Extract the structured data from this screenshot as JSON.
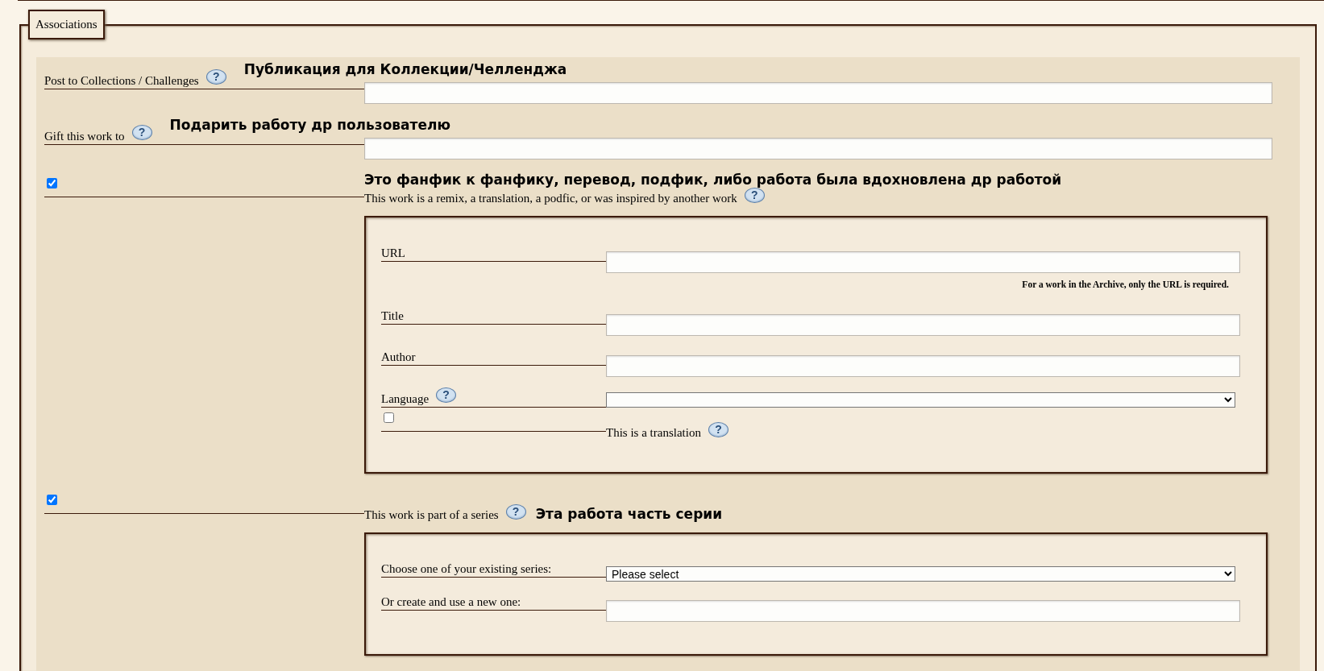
{
  "legend": "Associations",
  "rows": [
    {
      "kind": "text",
      "label": "Post to Collections / Challenges",
      "help": "?",
      "annotation": {
        "kind": "inline",
        "text": "Публикация для Коллекции/Челленджа"
      }
    },
    {
      "kind": "text",
      "label": "Gift this work to",
      "help": "?",
      "annotation": {
        "kind": "inline",
        "text": "Подарить работу др пользователю"
      }
    },
    {
      "kind": "check",
      "checked": true,
      "label": "This work is a remix, a translation, a podfic, or was inspired by another work",
      "help": "?",
      "annotation": {
        "kind": "above",
        "text": "Это фанфик к фанфику, перевод, подфик, либо работа была вдохновлена др работой"
      },
      "fields": [
        {
          "kind": "text",
          "label": "URL",
          "note": "For a work in the Archive, only the URL is required."
        },
        {
          "kind": "text",
          "label": "Title"
        },
        {
          "kind": "text",
          "label": "Author"
        },
        {
          "kind": "select",
          "label": "Language",
          "help": "?"
        },
        {
          "kind": "check",
          "checked": false,
          "label": "This is a translation",
          "help": "?"
        }
      ]
    },
    {
      "kind": "check",
      "checked": true,
      "label": "This work is part of a series",
      "help": "?",
      "annotation": {
        "kind": "inline",
        "text": "Эта работа часть серии"
      },
      "fields": [
        {
          "kind": "select",
          "label": "Choose one of your existing series:",
          "value": "Please select"
        },
        {
          "kind": "text",
          "label": "Or create and use a new one:"
        }
      ]
    }
  ]
}
